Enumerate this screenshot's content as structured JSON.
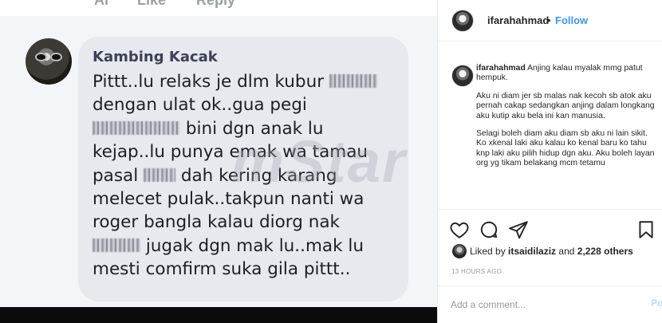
{
  "facebook_screenshot": {
    "top_strip_fragments": [
      "Ar",
      "Like",
      "Reply"
    ],
    "commenter_name": "Kambing Kacak",
    "comment_lines": [
      [
        "Pittt..lu relaks je dlm kubur ",
        {
          "blur": 60
        }
      ],
      [
        "dengan ulat ok..gua pegi"
      ],
      [
        {
          "blur": 110
        },
        " bini dgn anak lu"
      ],
      [
        "kejap..lu punya emak wa tamau"
      ],
      [
        "pasal ",
        {
          "blur": 40
        },
        " dah kering karang"
      ],
      [
        "melecet pulak..takpun nanti wa"
      ],
      [
        "roger bangla kalau diorg nak"
      ],
      [
        {
          "blur": 60
        },
        " jugak dgn mak lu..mak lu"
      ],
      [
        "mesti comfirm suka gila pittt.."
      ]
    ],
    "watermark": "mStar"
  },
  "instagram": {
    "header": {
      "username": "ifarahahmad",
      "separator": "•",
      "follow_label": "Follow"
    },
    "caption": {
      "username": "ifarahahmad",
      "paragraphs": [
        "Anjing kalau myalak mmg patut hempuk.",
        "Aku ni diam jer sb malas nak kecoh sb atok aku pernah cakap sedangkan anjing dalam longkang aku kutip aku bela ini kan manusia.",
        "Selagi boleh diam aku diam sb aku ni lain sikit. Ko xkenal laki aku kalau ko kenal baru ko tahu knp laki aku pilih hidup dgn aku. Aku boleh layan org yg tikam belakang mcm tetamu"
      ]
    },
    "actions": {
      "icons": [
        "heart-icon",
        "comment-icon",
        "share-icon",
        "bookmark-icon"
      ]
    },
    "likes": {
      "prefix": "Liked by ",
      "user": "itsaidilaziz",
      "middle": " and ",
      "count": "2,228 others"
    },
    "timestamp": "13 HOURS AGO",
    "comment": {
      "placeholder": "Add a comment...",
      "post_label": "Post"
    },
    "colors": {
      "link_blue": "#3897f0",
      "text": "#262626",
      "muted": "#999999",
      "post_disabled": "#b2dffc"
    }
  }
}
